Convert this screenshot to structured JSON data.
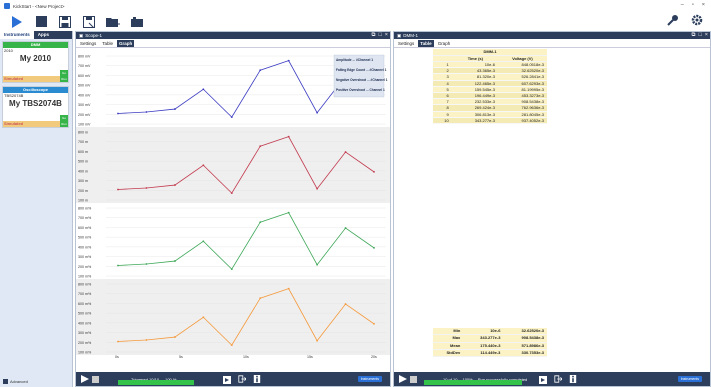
{
  "window": {
    "title": "KickStart - <New Project>"
  },
  "left_panel": {
    "tabs": [
      "Instruments",
      "Apps"
    ],
    "instruments": [
      {
        "header": "DMM",
        "sub": "2010",
        "name": "My 2010",
        "status": "Simulated",
        "go": "Go Run"
      },
      {
        "header": "Oscilloscope",
        "sub": "TBS2074B",
        "name": "My TBS2074B",
        "status": "Simulated",
        "go": "Go Run"
      }
    ],
    "advanced": "Advanced"
  },
  "scope": {
    "title": "Scope-1",
    "tabs": [
      "Settings",
      "Table",
      "Graph"
    ],
    "active_tab": "Graph",
    "legend": [
      "Amplitude ... #Channel 1",
      "Falling Edge Count ... #Channel 1",
      "Negative Overshoot ... #Channel 1",
      "Positive Overshoot ... Channel 1"
    ],
    "bottom": {
      "status": "Triggered 10/10",
      "percent": "100 %",
      "instruments": "Instruments"
    }
  },
  "dmm": {
    "title": "DMM-1",
    "tabs": [
      "Settings",
      "Table",
      "Graph"
    ],
    "active_tab": "Table",
    "table_title": "DMM-1",
    "headers": [
      "",
      "Time (s)",
      "Voltage (V)"
    ],
    "rows": [
      [
        "1",
        "10e-6",
        "848.0518e-3"
      ],
      [
        "2",
        "43.365e-3",
        "32.62520e-3"
      ],
      [
        "3",
        "81.320e-3",
        "526.2841e-3"
      ],
      [
        "4",
        "122.465e-3",
        "607.6293e-3"
      ],
      [
        "5",
        "159.545e-3",
        "81.19995e-3"
      ],
      [
        "6",
        "196.449e-3",
        "453.3273e-3"
      ],
      [
        "7",
        "232.533e-3",
        "908.5438e-3"
      ],
      [
        "8",
        "269.424e-3",
        "762.9636e-3"
      ],
      [
        "9",
        "306.813e-3",
        "281.8045e-3"
      ],
      [
        "10",
        "343.277e-3",
        "937.4052e-3"
      ]
    ],
    "stats": [
      [
        "Min",
        "10e-6",
        "32.62520e-3"
      ],
      [
        "Max",
        "343.277e-3",
        "908.5438e-3"
      ],
      [
        "Mean",
        "175.440e-3",
        "571.8986e-3"
      ],
      [
        "StdDev",
        "114.449e-3",
        "330.7353e-3"
      ]
    ],
    "bottom": {
      "status": "10 of 10",
      "percent": "100%",
      "message": "Run successfully completed",
      "instruments": "Instruments"
    }
  },
  "chart_data": {
    "type": "line",
    "x": [
      0,
      1,
      2,
      3,
      4,
      5,
      6,
      7,
      8,
      9
    ],
    "x_ticks": [
      "0s",
      "5s",
      "10s",
      "15s",
      "20s"
    ],
    "series": [
      {
        "name": "Amplitude",
        "color": "#3d3dc2",
        "values": [
          130,
          150,
          190,
          460,
          80,
          720,
          850,
          140,
          640,
          370
        ],
        "y_ticks": [
          "800 mV",
          "700 mV",
          "600 mV",
          "500 mV",
          "400 mV",
          "300 mV",
          "200 mV",
          "100 mV"
        ]
      },
      {
        "name": "Falling Edge Count",
        "color": "#c23b4f",
        "values": [
          130,
          150,
          190,
          460,
          80,
          720,
          850,
          140,
          640,
          370
        ],
        "y_ticks": [
          "800 m",
          "700 m",
          "600 m",
          "500 m",
          "400 m",
          "300 m",
          "200 m",
          "100 m"
        ]
      },
      {
        "name": "Negative Overshoot",
        "color": "#3fa859",
        "values": [
          130,
          150,
          190,
          460,
          80,
          720,
          850,
          140,
          640,
          370
        ],
        "y_ticks": [
          "800 m%",
          "700 m%",
          "600 m%",
          "500 m%",
          "400 m%",
          "300 m%",
          "200 m%",
          "100 m%"
        ]
      },
      {
        "name": "Positive Overshoot",
        "color": "#f59a3c",
        "values": [
          130,
          150,
          190,
          460,
          80,
          720,
          850,
          140,
          640,
          370
        ],
        "y_ticks": [
          "800 m%",
          "700 m%",
          "600 m%",
          "500 m%",
          "400 m%",
          "300 m%",
          "200 m%",
          "100 m%"
        ]
      }
    ]
  }
}
